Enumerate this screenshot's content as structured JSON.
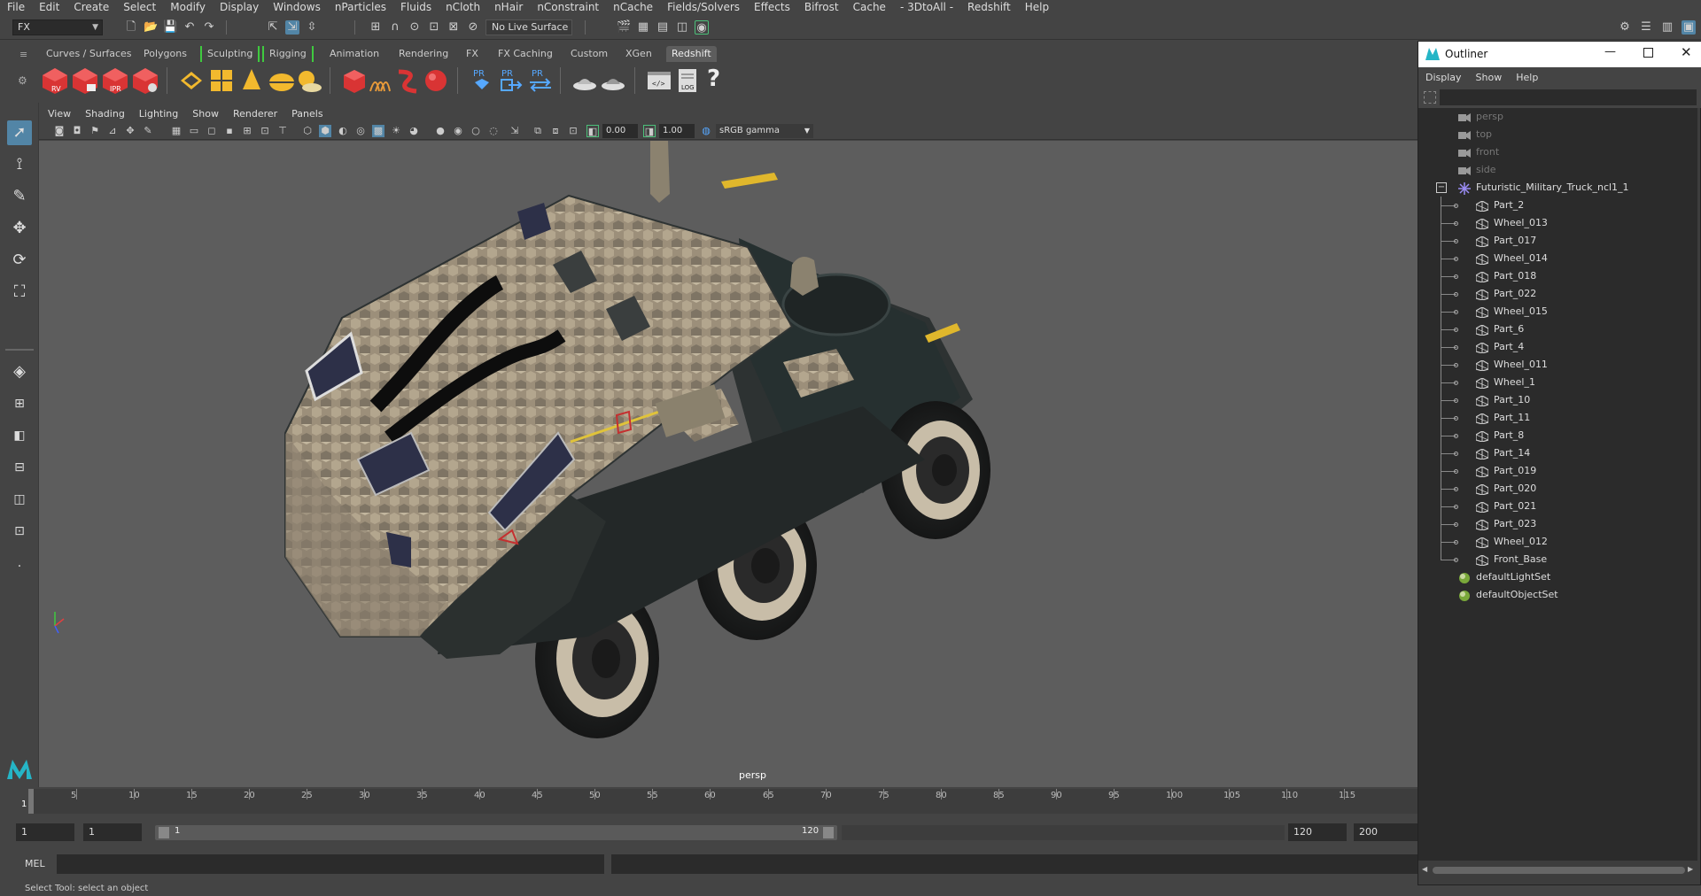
{
  "menubar": [
    "File",
    "Edit",
    "Create",
    "Select",
    "Modify",
    "Display",
    "Windows",
    "nParticles",
    "Fluids",
    "nCloth",
    "nHair",
    "nConstraint",
    "nCache",
    "Fields/Solvers",
    "Effects",
    "Bifrost",
    "Cache",
    "- 3DtoAll -",
    "Redshift",
    "Help"
  ],
  "status": {
    "menuset": "FX",
    "live_surface": "No Live Surface"
  },
  "shelf_tabs": [
    {
      "label": "Curves / Surfaces",
      "active": false
    },
    {
      "label": "Polygons",
      "active": false
    },
    {
      "label": "Sculpting",
      "active": false
    },
    {
      "label": "Rigging",
      "active": false
    },
    {
      "label": "Animation",
      "active": false
    },
    {
      "label": "Rendering",
      "active": false
    },
    {
      "label": "FX",
      "active": false
    },
    {
      "label": "FX Caching",
      "active": false
    },
    {
      "label": "Custom",
      "active": false
    },
    {
      "label": "XGen",
      "active": false
    },
    {
      "label": "Redshift",
      "active": true
    }
  ],
  "shelf_icon_labels": {
    "rv": "RV",
    "ipr": "IPR",
    "pr": "PR",
    "log": "LOG",
    "help": "?"
  },
  "panel_menu": [
    "View",
    "Shading",
    "Lighting",
    "Show",
    "Renderer",
    "Panels"
  ],
  "panel_toolbar": {
    "exposure": "0.00",
    "gamma": "1.00",
    "color_space": "sRGB gamma"
  },
  "viewport": {
    "camera": "persp",
    "background_color": "#5d5d5d"
  },
  "timeline": {
    "ticks": [
      "5",
      "10",
      "15",
      "20",
      "25",
      "30",
      "35",
      "40",
      "45",
      "50",
      "55",
      "60",
      "65",
      "70",
      "75",
      "80",
      "85",
      "90",
      "95",
      "100",
      "105",
      "110",
      "115"
    ],
    "current_frame": "1"
  },
  "range": {
    "start": "1",
    "playback_start": "1",
    "slider_start": "1",
    "slider_end": "120",
    "playback_end": "120",
    "end": "200"
  },
  "command_line": {
    "mode": "MEL"
  },
  "help_line": "Select Tool: select an object",
  "outliner": {
    "title": "Outliner",
    "menu": [
      "Display",
      "Show",
      "Help"
    ],
    "cameras": [
      "persp",
      "top",
      "front",
      "side"
    ],
    "group": "Futuristic_Military_Truck_ncl1_1",
    "children": [
      "Part_2",
      "Wheel_013",
      "Part_017",
      "Wheel_014",
      "Part_018",
      "Part_022",
      "Wheel_015",
      "Part_6",
      "Part_4",
      "Wheel_011",
      "Wheel_1",
      "Part_10",
      "Part_11",
      "Part_8",
      "Part_14",
      "Part_019",
      "Part_020",
      "Part_021",
      "Part_023",
      "Wheel_012",
      "Front_Base"
    ],
    "sets": [
      "defaultLightSet",
      "defaultObjectSet"
    ]
  }
}
